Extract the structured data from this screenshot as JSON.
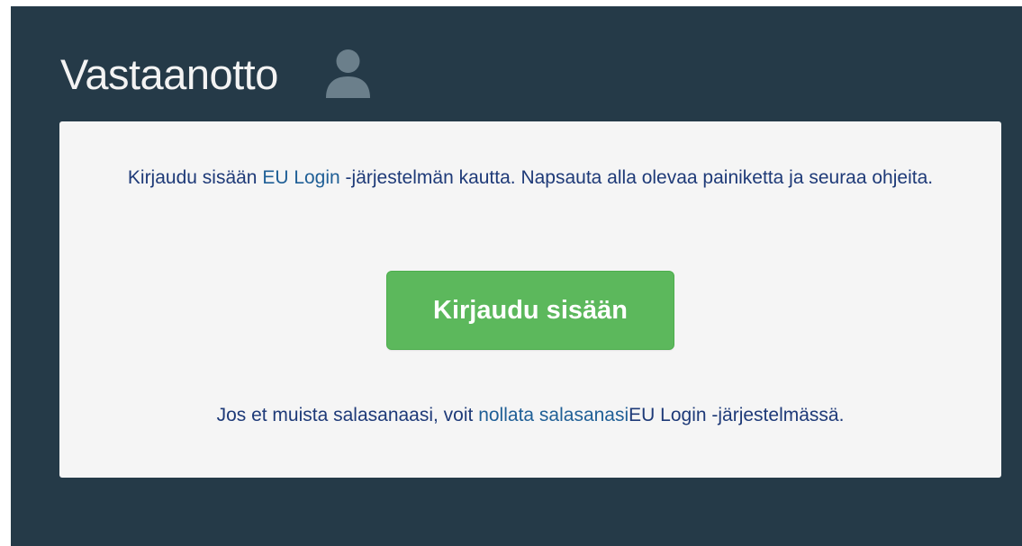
{
  "header": {
    "title": "Vastaanotto",
    "icon": "user-icon"
  },
  "card": {
    "intro_before_link": "Kirjaudu sisään ",
    "intro_link": "EU Login",
    "intro_after_link": " -järjestelmän kautta. Napsauta alla olevaa painiketta ja seuraa ohjeita.",
    "login_button_label": "Kirjaudu sisään",
    "forgot_before_link": "Jos et muista salasanaasi, voit ",
    "forgot_link": "nollata salasanasi",
    "forgot_after_link": "EU Login -järjestelmässä."
  },
  "colors": {
    "background": "#253a48",
    "card": "#f5f5f5",
    "button": "#5cb85c",
    "text": "#1e3a78",
    "link": "#1f5f96"
  }
}
